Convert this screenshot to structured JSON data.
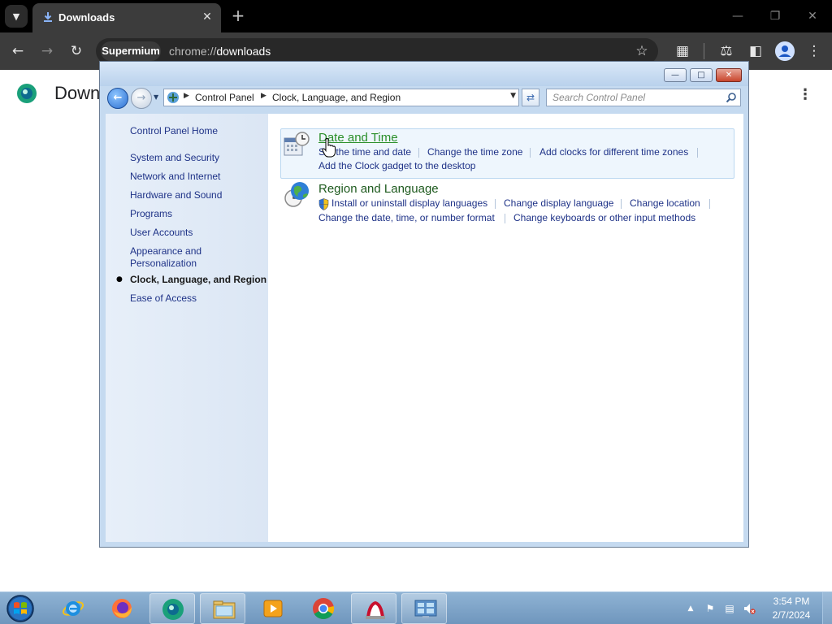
{
  "browser": {
    "tab_title": "Downloads",
    "site_chip": "Supermium",
    "url_prefix": "chrome://",
    "url_path": "downloads",
    "page_title": "Downloads",
    "page_title_visible": "Down"
  },
  "control_panel": {
    "breadcrumb": [
      "Control Panel",
      "Clock, Language, and Region"
    ],
    "search_placeholder": "Search Control Panel",
    "sidebar": {
      "home": "Control Panel Home",
      "items": [
        "System and Security",
        "Network and Internet",
        "Hardware and Sound",
        "Programs",
        "User Accounts",
        "Appearance and",
        "Personalization",
        "Clock, Language, and Region",
        "Ease of Access"
      ],
      "current": "Clock, Language, and Region"
    },
    "categories": [
      {
        "title": "Date and Time",
        "icon": "calendar-clock-icon",
        "tasks": [
          "Set the time and date",
          "Change the time zone",
          "Add clocks for different time zones",
          "Add the Clock gadget to the desktop"
        ]
      },
      {
        "title": "Region and Language",
        "icon": "globe-clock-icon",
        "tasks": [
          "Install or uninstall display languages",
          "Change display language",
          "Change location",
          "Change the date, time, or number format",
          "Change keyboards or other input methods"
        ]
      }
    ]
  },
  "taskbar": {
    "apps": [
      "start-orb-icon",
      "internet-explorer-icon",
      "firefox-icon",
      "supermium-icon",
      "file-explorer-icon",
      "media-player-icon",
      "chrome-icon",
      "adobe-reader-icon",
      "control-panel-icon"
    ],
    "clock_time": "3:54 PM",
    "clock_date": "2/7/2024"
  },
  "colors": {
    "browser_frame": "#000000",
    "browser_toolbar": "#3c3c3c",
    "cp_link": "#1e3287",
    "cp_category_title": "#1e5a1e",
    "taskbar": "#7fa5c9"
  }
}
